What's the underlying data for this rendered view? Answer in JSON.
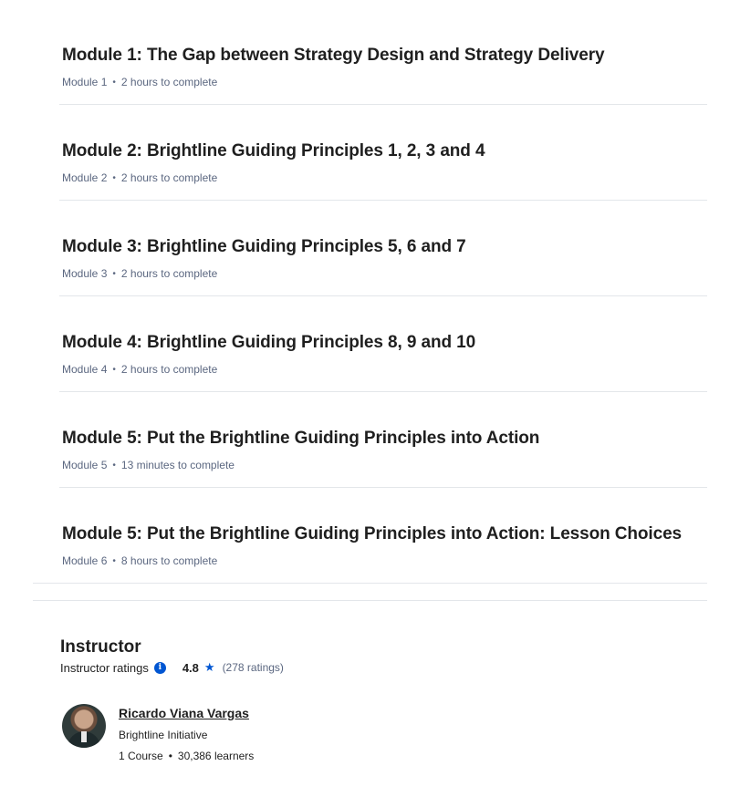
{
  "modules": [
    {
      "title": "Module 1: The Gap between Strategy Design and Strategy Delivery",
      "number": "Module 1",
      "duration": "2 hours to complete"
    },
    {
      "title": "Module 2: Brightline Guiding Principles 1, 2, 3 and 4",
      "number": "Module 2",
      "duration": "2 hours to complete"
    },
    {
      "title": "Module 3: Brightline Guiding Principles 5, 6 and 7",
      "number": "Module 3",
      "duration": "2 hours to complete"
    },
    {
      "title": "Module 4: Brightline Guiding Principles 8, 9 and 10",
      "number": "Module 4",
      "duration": "2 hours to complete"
    },
    {
      "title": "Module 5: Put the Brightline Guiding Principles into Action",
      "number": "Module 5",
      "duration": "13 minutes to complete"
    },
    {
      "title": "Module 5: Put the Brightline Guiding Principles into Action: Lesson Choices",
      "number": "Module 6",
      "duration": "8 hours to complete"
    }
  ],
  "meta_separator": "•",
  "instructor_section": {
    "heading": "Instructor",
    "ratings_label": "Instructor ratings",
    "info_icon": "info-icon",
    "rating_value": "4.8",
    "star_icon": "★",
    "rating_count": "(278 ratings)",
    "accent_color": "#0056d2"
  },
  "instructor": {
    "name": "Ricardo Viana Vargas",
    "organization": "Brightline Initiative",
    "courses": "1 Course",
    "learners": "30,386 learners",
    "separator": "•"
  }
}
